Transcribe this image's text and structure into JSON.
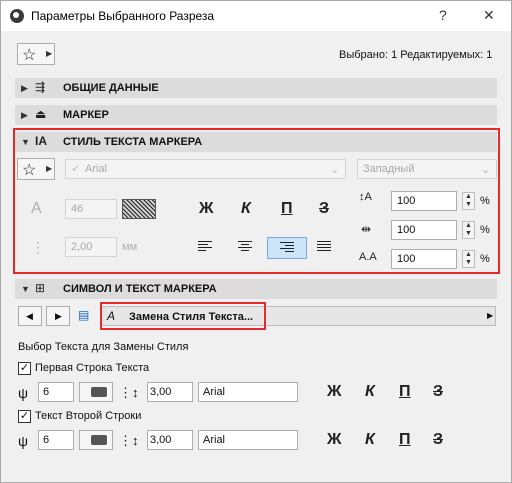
{
  "window": {
    "title": "Параметры Выбранного Разреза",
    "help": "?",
    "close": "✕"
  },
  "selection": {
    "status": "Выбрано: 1 Редактируемых: 1"
  },
  "sections": {
    "general": "ОБЩИЕ ДАННЫЕ",
    "marker": "МАРКЕР",
    "text_style": "СТИЛЬ ТЕКСТА МАРКЕРА",
    "symbol_text": "СИМВОЛ И ТЕКСТ МАРКЕРА"
  },
  "text_style": {
    "font": "Arial",
    "script": "Западный",
    "size": "46",
    "spacing": "2,00",
    "spacing_unit": "мм",
    "bold": "Ж",
    "italic": "К",
    "underline": "П",
    "strike": "З",
    "width_pct": "100",
    "spacing_pct": "100",
    "slant_pct": "100",
    "pct": "%"
  },
  "nav": {
    "replace_button": "Замена Стиля Текста..."
  },
  "replace_panel": {
    "heading": "Выбор Текста для Замены Стиля",
    "row1": {
      "label": "Первая Строка Текста",
      "size": "6",
      "spacing": "3,00",
      "font": "Arial"
    },
    "row2": {
      "label": "Текст Второй Строки",
      "size": "6",
      "spacing": "3,00",
      "font": "Arial"
    },
    "bold": "Ж",
    "italic": "К",
    "underline": "П",
    "strike": "З"
  }
}
